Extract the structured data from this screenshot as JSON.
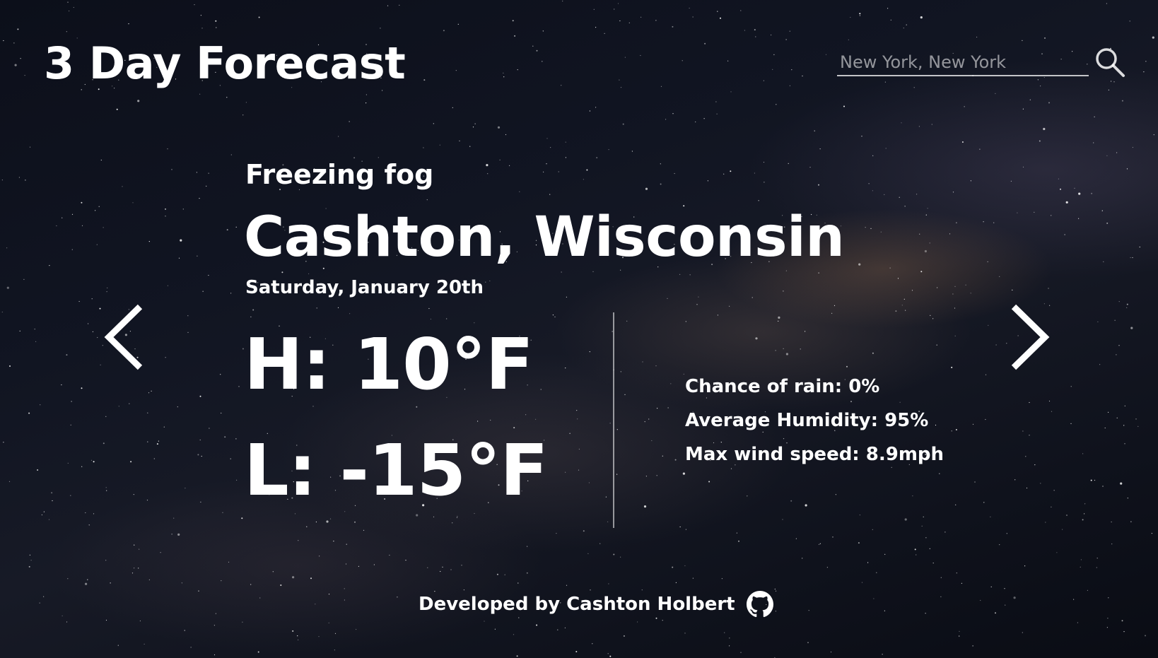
{
  "app": {
    "title": "3 Day Forecast"
  },
  "search": {
    "placeholder": "New York, New York",
    "value": "",
    "icon": "search-icon"
  },
  "forecast": {
    "condition": "Freezing fog",
    "location": "Cashton, Wisconsin",
    "date": "Saturday, January 20th",
    "high": "H: 10°F",
    "low": "L: -15°F",
    "details": [
      "Chance of rain: 0%",
      "Average Humidity: 95%",
      "Max wind speed: 8.9mph"
    ]
  },
  "navigation": {
    "prev_icon": "chevron-left-icon",
    "next_icon": "chevron-right-icon"
  },
  "footer": {
    "text": "Developed by Cashton Holbert",
    "icon": "github-icon"
  },
  "colors": {
    "text": "#ffffff",
    "background": "#111522"
  }
}
